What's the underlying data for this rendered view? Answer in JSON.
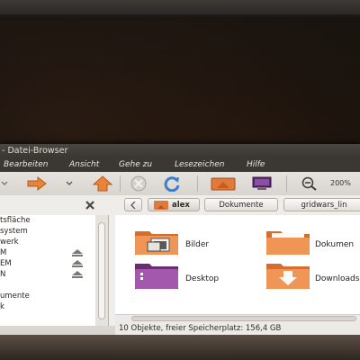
{
  "window": {
    "title": "- Datei-Browser"
  },
  "menu": [
    "Bearbeiten",
    "Ansicht",
    "Gehe zu",
    "Lesezeichen",
    "Hilfe"
  ],
  "toolbar": {
    "zoom": "200%"
  },
  "location": {
    "crumbs": [
      "alex",
      "Dokumente",
      "gridwars_lin"
    ]
  },
  "sidebar": {
    "items": [
      "tsfläche",
      "system",
      "werk",
      "M",
      "EM",
      "N",
      "umente",
      "k"
    ]
  },
  "files": [
    {
      "name": "Bilder",
      "icon": "pictures-folder-icon"
    },
    {
      "name": "Dokumen",
      "icon": "documents-folder-icon"
    },
    {
      "name": "Desktop",
      "icon": "desktop-folder-icon"
    },
    {
      "name": "Downloads",
      "icon": "downloads-folder-icon"
    }
  ],
  "status": "10 Objekte, freier Speicherplatz: 156,4 GB",
  "colors": {
    "accent_orange": "#e07b39",
    "folder_orange": "#e8884a",
    "desktop_purple": "#8a3f8c"
  }
}
